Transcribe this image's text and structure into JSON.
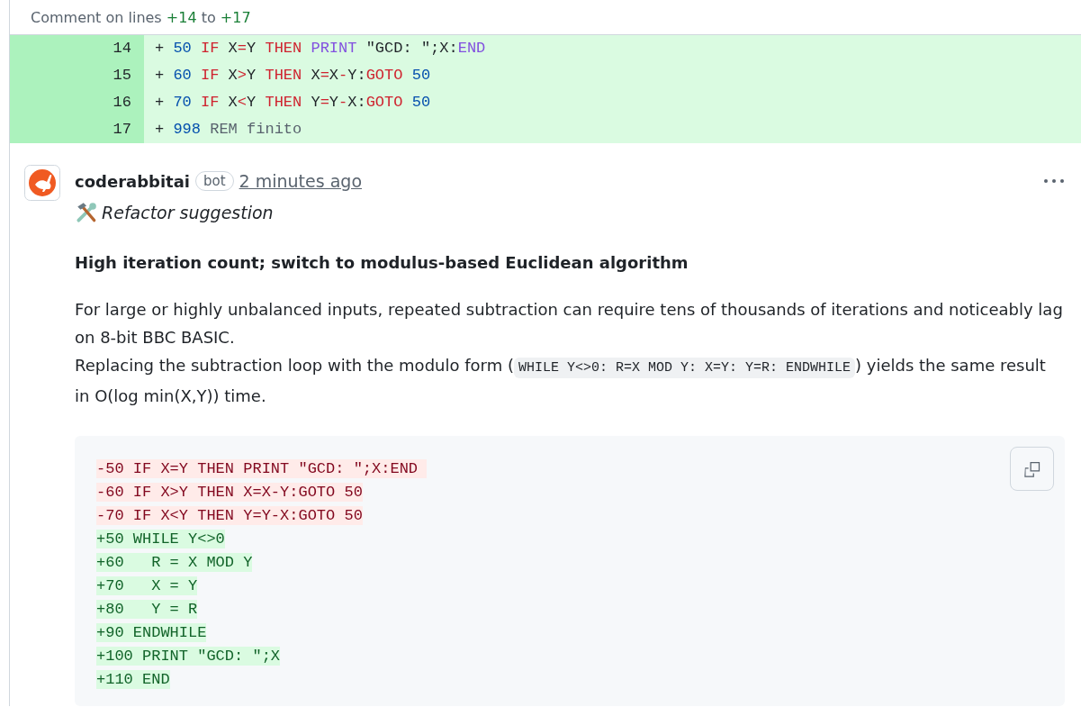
{
  "header": {
    "prefix": "Comment on lines",
    "start": "+14",
    "middle": "to",
    "end": "+17"
  },
  "diff_lines": [
    {
      "number": "14",
      "tokens": [
        {
          "kind": "plain",
          "text": "+ "
        },
        {
          "kind": "num",
          "text": "50"
        },
        {
          "kind": "kw",
          "text": " IF"
        },
        {
          "kind": "plain",
          "text": " X"
        },
        {
          "kind": "kw",
          "text": "="
        },
        {
          "kind": "plain",
          "text": "Y "
        },
        {
          "kind": "kw",
          "text": "THEN"
        },
        {
          "kind": "fn",
          "text": " PRINT"
        },
        {
          "kind": "plain",
          "text": " \"GCD: \";X:"
        },
        {
          "kind": "fn",
          "text": "END"
        }
      ]
    },
    {
      "number": "15",
      "tokens": [
        {
          "kind": "plain",
          "text": "+ "
        },
        {
          "kind": "num",
          "text": "60"
        },
        {
          "kind": "kw",
          "text": " IF"
        },
        {
          "kind": "plain",
          "text": " X"
        },
        {
          "kind": "kw",
          "text": ">"
        },
        {
          "kind": "plain",
          "text": "Y "
        },
        {
          "kind": "kw",
          "text": "THEN"
        },
        {
          "kind": "plain",
          "text": " X"
        },
        {
          "kind": "kw",
          "text": "="
        },
        {
          "kind": "plain",
          "text": "X"
        },
        {
          "kind": "kw",
          "text": "-"
        },
        {
          "kind": "plain",
          "text": "Y:"
        },
        {
          "kind": "kw",
          "text": "GOTO"
        },
        {
          "kind": "num",
          "text": " 50"
        }
      ]
    },
    {
      "number": "16",
      "tokens": [
        {
          "kind": "plain",
          "text": "+ "
        },
        {
          "kind": "num",
          "text": "70"
        },
        {
          "kind": "kw",
          "text": " IF"
        },
        {
          "kind": "plain",
          "text": " X"
        },
        {
          "kind": "kw",
          "text": "<"
        },
        {
          "kind": "plain",
          "text": "Y "
        },
        {
          "kind": "kw",
          "text": "THEN"
        },
        {
          "kind": "plain",
          "text": " Y"
        },
        {
          "kind": "kw",
          "text": "="
        },
        {
          "kind": "plain",
          "text": "Y"
        },
        {
          "kind": "kw",
          "text": "-"
        },
        {
          "kind": "plain",
          "text": "X:"
        },
        {
          "kind": "kw",
          "text": "GOTO"
        },
        {
          "kind": "num",
          "text": " 50"
        }
      ]
    },
    {
      "number": "17",
      "tokens": [
        {
          "kind": "plain",
          "text": "+ "
        },
        {
          "kind": "num",
          "text": "998"
        },
        {
          "kind": "comment",
          "text": " REM finito"
        }
      ]
    }
  ],
  "comment": {
    "author": "coderabbitai",
    "badge": "bot",
    "time": "2 minutes ago",
    "label": "Refactor suggestion",
    "heading": "High iteration count; switch to modulus-based Euclidean algorithm",
    "paragraphs": [
      [
        {
          "kind": "text",
          "text": "For large or highly unbalanced inputs, repeated subtraction can require tens of thousands of iterations and noticeably lag on 8-bit BBC BASIC."
        }
      ],
      [
        {
          "kind": "text",
          "text": "Replacing the subtraction loop with the modulo form ("
        },
        {
          "kind": "code",
          "text": "WHILE Y<>0: R=X MOD Y: X=Y: Y=R: ENDWHILE"
        },
        {
          "kind": "text",
          "text": ") yields the same result in O(log min(X,Y)) time."
        }
      ]
    ],
    "suggestion": [
      {
        "kind": "removed",
        "text": "-50 IF X=Y THEN PRINT \"GCD: \";X:END "
      },
      {
        "kind": "removed",
        "text": "-60 IF X>Y THEN X=X-Y:GOTO 50"
      },
      {
        "kind": "removed",
        "text": "-70 IF X<Y THEN Y=Y-X:GOTO 50"
      },
      {
        "kind": "added",
        "text": "+50 WHILE Y<>0"
      },
      {
        "kind": "added",
        "text": "+60   R = X MOD Y"
      },
      {
        "kind": "added",
        "text": "+70   X = Y"
      },
      {
        "kind": "added",
        "text": "+80   Y = R"
      },
      {
        "kind": "added",
        "text": "+90 ENDWHILE"
      },
      {
        "kind": "added",
        "text": "+100 PRINT \"GCD: \";X"
      },
      {
        "kind": "added",
        "text": "+110 END"
      }
    ]
  }
}
